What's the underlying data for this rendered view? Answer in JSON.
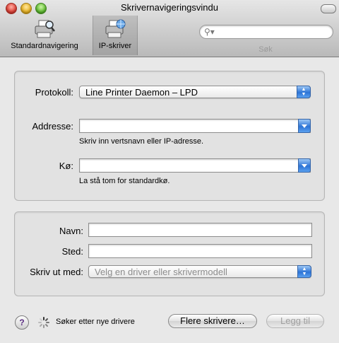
{
  "window": {
    "title": "Skrivernavigeringsvindu"
  },
  "toolbar": {
    "items": [
      {
        "label": "Standardnavigering",
        "icon": "printer-search-icon",
        "selected": false
      },
      {
        "label": "IP-skriver",
        "icon": "printer-network-icon",
        "selected": true
      }
    ],
    "search": {
      "label": "Søk",
      "placeholder": ""
    }
  },
  "connection": {
    "protocol_label": "Protokoll:",
    "protocol_value": "Line Printer Daemon – LPD",
    "address_label": "Addresse:",
    "address_value": "",
    "address_hint": "Skriv inn vertsnavn eller IP-adresse.",
    "queue_label": "Kø:",
    "queue_value": "",
    "queue_hint": "La stå tom for standardkø."
  },
  "details": {
    "name_label": "Navn:",
    "name_value": "",
    "location_label": "Sted:",
    "location_value": "",
    "print_with_label": "Skriv ut med:",
    "print_with_value": "Velg en driver eller skrivermodell"
  },
  "footer": {
    "help": "?",
    "status": "Søker etter nye drivere",
    "more_printers": "Flere skrivere…",
    "add": "Legg til"
  },
  "colors": {
    "accent": "#2d74d6",
    "window_bg": "#e8e8e8"
  }
}
